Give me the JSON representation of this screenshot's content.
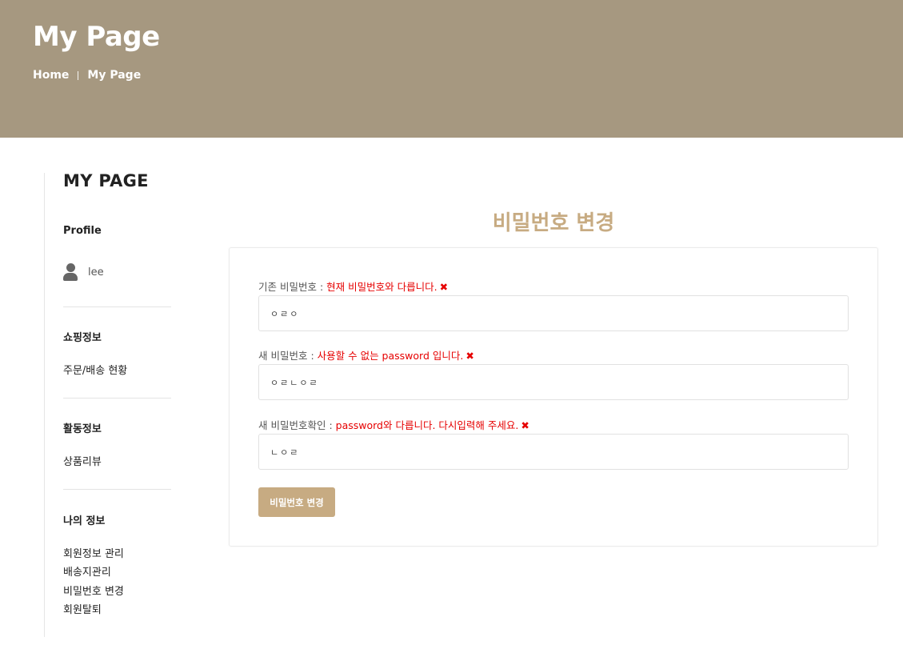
{
  "header": {
    "title": "My Page",
    "breadcrumb": [
      "Home",
      "My Page"
    ],
    "background_color": "#a69880"
  },
  "sidebar": {
    "title": "MY PAGE",
    "profile": {
      "heading": "Profile",
      "icon": "user-icon",
      "username": "lee"
    },
    "sections": [
      {
        "heading": "쇼핑정보",
        "links": [
          "주문/배송 현황"
        ]
      },
      {
        "heading": "활동정보",
        "links": [
          "상품리뷰"
        ]
      },
      {
        "heading": "나의 정보",
        "links": [
          "회원정보 관리",
          "배송지관리",
          "비밀번호 변경",
          "회원탈퇴"
        ]
      }
    ]
  },
  "main": {
    "heading": "비밀번호 변경",
    "accent_color": "#c7ab82",
    "error_color": "#e60000",
    "fields": [
      {
        "label": "기존 비밀번호 : ",
        "error": "현재 비밀번호와 다릅니다.",
        "error_icon": "✖",
        "value": "ㅇㄹㅇ"
      },
      {
        "label": "새 비밀번호 : ",
        "error": "사용할 수 없는 password 입니다.",
        "error_icon": "✖",
        "value": "ㅇㄹㄴㅇㄹ"
      },
      {
        "label": "새 비밀번호확인 : ",
        "error": "password와 다릅니다. 다시입력해 주세요.",
        "error_icon": "✖",
        "value": "ㄴㅇㄹ"
      }
    ],
    "submit_label": "비밀번호 변경"
  }
}
